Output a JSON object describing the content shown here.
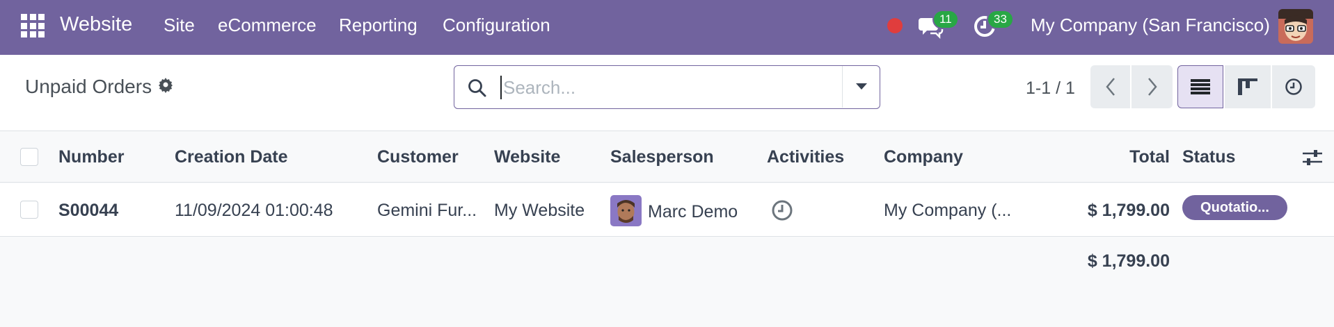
{
  "navbar": {
    "brand": "Website",
    "menus": [
      "Site",
      "eCommerce",
      "Reporting",
      "Configuration"
    ],
    "messages_count": "11",
    "activities_count": "33",
    "company": "My Company (San Francisco)"
  },
  "control": {
    "title": "Unpaid Orders",
    "search_placeholder": "Search...",
    "pager": "1-1 / 1"
  },
  "table": {
    "columns": [
      "Number",
      "Creation Date",
      "Customer",
      "Website",
      "Salesperson",
      "Activities",
      "Company",
      "Total",
      "Status"
    ],
    "rows": [
      {
        "number": "S00044",
        "creation_date": "11/09/2024 01:00:48",
        "customer": "Gemini Fur...",
        "website": "My Website",
        "salesperson": "Marc Demo",
        "company": "My Company (...",
        "total": "$ 1,799.00",
        "status": "Quotatio..."
      }
    ],
    "footer_total": "$ 1,799.00"
  },
  "colors": {
    "brand": "#71639e",
    "badge": "#28a745",
    "record": "#e03d3d"
  }
}
